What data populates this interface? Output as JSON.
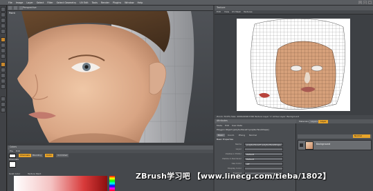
{
  "menu": {
    "items": [
      "File",
      "Image",
      "Layer",
      "Select",
      "Filter",
      "Select Geometry",
      "UV Edit",
      "Tools",
      "Render",
      "Plugins",
      "Window",
      "Help"
    ]
  },
  "viewport": {
    "tab": "Perspective",
    "label": "Paint"
  },
  "texture_view": {
    "title": "Texture",
    "menu": [
      "Edit",
      "View",
      "UV Mesh",
      "Textures"
    ],
    "status": "Zoom: 53.8%  Size: 4096x4096  8 Bit  Texture Layer '1' Active Layer: Background"
  },
  "attributes": {
    "title": "Attributes",
    "menu": [
      "Mode",
      "Edit",
      "User Data"
    ],
    "object_line": "Polygon Object [polySurface27.polySurfaceShape]",
    "tabs": [
      "Basic",
      "Coord.",
      "Phong",
      "Normal"
    ],
    "section": "Basic Properties",
    "rows": [
      {
        "label": "Name",
        "value": "polySurface27 polySurfaceShape"
      },
      {
        "label": "Layer",
        "value": ""
      },
      {
        "label": "Visible in Editor",
        "value": "Default"
      },
      {
        "label": "Visible in Renderer",
        "value": "Default"
      },
      {
        "label": "Use Color",
        "value": "Off"
      },
      {
        "label": "Display Color",
        "value": ""
      },
      {
        "label": "Enabled",
        "value": ""
      },
      {
        "label": "X-Ray",
        "value": ""
      }
    ]
  },
  "layers": {
    "tabs": [
      "Materials",
      "Layers",
      "Layer"
    ],
    "blend_label": "Normal",
    "layer_name": "Background"
  },
  "color": {
    "title": "Colors",
    "menu": [
      "File",
      "Edit"
    ],
    "tabs": [
      "Channels",
      "Blending",
      "Color",
      "Unlimited"
    ],
    "section": "Channels",
    "color_label": "Solid Color",
    "texture_label": "Texture Paint"
  },
  "watermark": "ZBrush学习吧  【www.linecg.com/tieba/1802】",
  "colors": {
    "menubar": "#5a5d61",
    "panel": "#45484c",
    "accent_orange": "#e8a42a",
    "watermark": "#ffffff"
  }
}
